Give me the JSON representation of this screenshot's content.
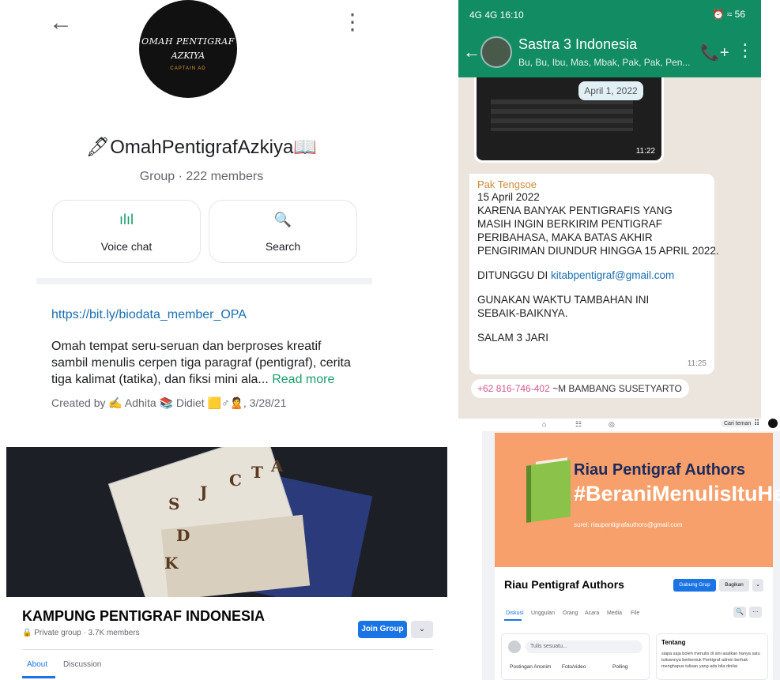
{
  "omah": {
    "back_icon": "←",
    "menu_icon": "⋮",
    "logo_line1": "OMAH PENTIGRAF",
    "logo_line2": "AZKIYA",
    "logo_line3": "CAPTAIN AD",
    "group_name": "🖋OmahPentigrafAzkiya📖",
    "group_meta": "Group · 222 members",
    "voice_chat_icon": "ılıl",
    "voice_chat_label": "Voice chat",
    "search_icon": "🔍",
    "search_label": "Search",
    "link": "https://bit.ly/biodata_member_OPA",
    "description": "Omah tempat seru-seruan dan berproses kreatif sambil menulis cerpen tiga paragraf (pentigraf), cerita tiga kalimat (tatika), dan fiksi mini ala...",
    "read_more": "Read more",
    "created_by": "Created by ✍ Adhita 📚 Didiet 🟨♂🙎, 3/28/21",
    "accent_color": "#1a9e6a"
  },
  "whatsapp": {
    "status_left": "4G 4G 16:10",
    "status_right": "⏰ ≈ 56",
    "group_name": "Sastra 3 Indonesia",
    "members": "Bu, Bu, Ibu, Mas, Mbak, Pak, Pak, Pen...",
    "call_icon": "📞+",
    "menu_icon": "⋮",
    "back_icon": "←",
    "date_badge": "April 1, 2022",
    "image_time": "11:22",
    "sender": "Pak Tengsoe",
    "lines": [
      "15 April 2022",
      "KARENA BANYAK PENTIGRAFIS YANG",
      "MASIH INGIN BERKIRIM PENTIGRAF",
      "PERIBAHASA, MAKA BATAS AKHIR",
      "PENGIRIMAN DIUNDUR HINGGA 15 APRIL 2022."
    ],
    "wait_prefix": "DITUNGGU DI ",
    "email": "kitabpentigraf@gmail.com",
    "use_line1": "GUNAKAN WAKTU TAMBAHAN INI",
    "use_line2": "SEBAIK-BAIKNYA.",
    "salam": "SALAM 3 JARI",
    "message_time": "11:25",
    "phone": "+62 816-746-402",
    "phone_name": "~M BAMBANG SUSETYARTO",
    "header_color": "#128c62"
  },
  "kampung": {
    "cover_letters": [
      "S",
      "J",
      "C",
      "T",
      "A",
      "D",
      "K"
    ],
    "title": "KAMPUNG PENTIGRAF INDONESIA",
    "meta": "🔒 Private group · 3.7K members",
    "join_label": "Join Group",
    "more_icon": "⌄",
    "tabs": [
      "About",
      "Discussion"
    ],
    "accent_color": "#1b74e4"
  },
  "riau": {
    "top_icons": [
      "⌂",
      "☷",
      "◎"
    ],
    "search_label": "Cari teman",
    "grid_icon": "⠿",
    "cover_title": "Riau Pentigraf Authors",
    "cover_hashtag": "#BeraniMenulisItuHebat",
    "cover_email": "surel: riaupentigrafauthors@gmail.com",
    "group_name": "Riau Pentigraf Authors",
    "join_label": "Gabung Grup",
    "share_label": "Bagikan",
    "more_icon": "⌄",
    "tabs": [
      "Diskusi",
      "Unggulan",
      "Orang",
      "Acara",
      "Media",
      "File"
    ],
    "search_icon": "🔍",
    "dots_icon": "···",
    "compose_placeholder": "Tulis sesuatu...",
    "actions": [
      "Postingan Anonim",
      "Foto/video",
      "Polling"
    ],
    "about_title": "Tentang",
    "about_text": "siapa saja boleh menulis di sini asalkan hanya satu tulisannya berbentuk Pentigraf admin berhak menghapus tulisan yang ada bila dinilai",
    "cover_color": "#f7a06c"
  }
}
